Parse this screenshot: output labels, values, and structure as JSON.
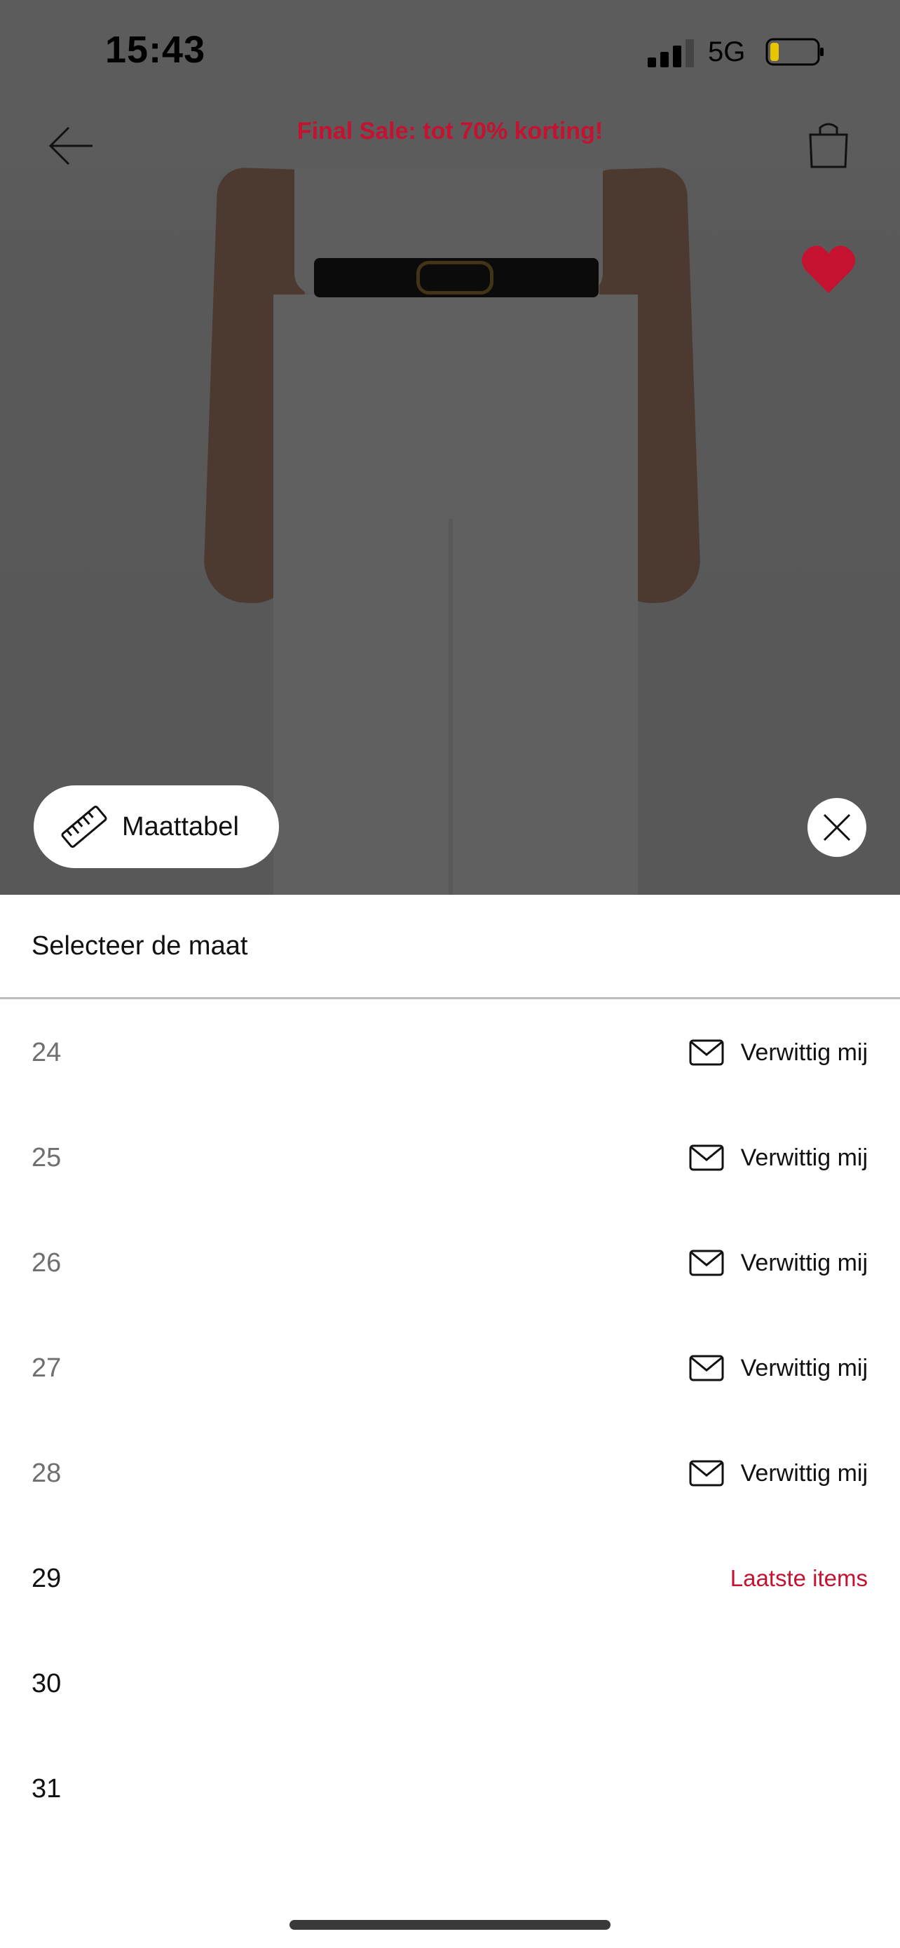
{
  "status_bar": {
    "time": "15:43",
    "network": "5G",
    "icons": [
      "signal-icon",
      "battery-icon"
    ]
  },
  "header": {
    "promo": "Final Sale: tot 70% korting!",
    "promo_color": "#c41230",
    "icons": [
      "back-arrow-icon",
      "shopping-bag-icon",
      "heart-icon"
    ]
  },
  "product_image": {
    "icons": [
      "ruler-icon",
      "close-icon"
    ],
    "size_guide_label": "Maattabel"
  },
  "size_sheet": {
    "title": "Selecteer de maat",
    "notify_label": "Verwittig mij",
    "sizes": [
      {
        "size": "24",
        "status": "Verwittig mij"
      },
      {
        "size": "25",
        "status": "Verwittig mij"
      },
      {
        "size": "26",
        "status": "Verwittig mij"
      },
      {
        "size": "27",
        "status": "Verwittig mij"
      },
      {
        "size": "28",
        "status": "Verwittig mij"
      },
      {
        "size": "29",
        "status": "Laatste items"
      },
      {
        "size": "30",
        "status": ""
      },
      {
        "size": "31",
        "status": ""
      }
    ]
  }
}
